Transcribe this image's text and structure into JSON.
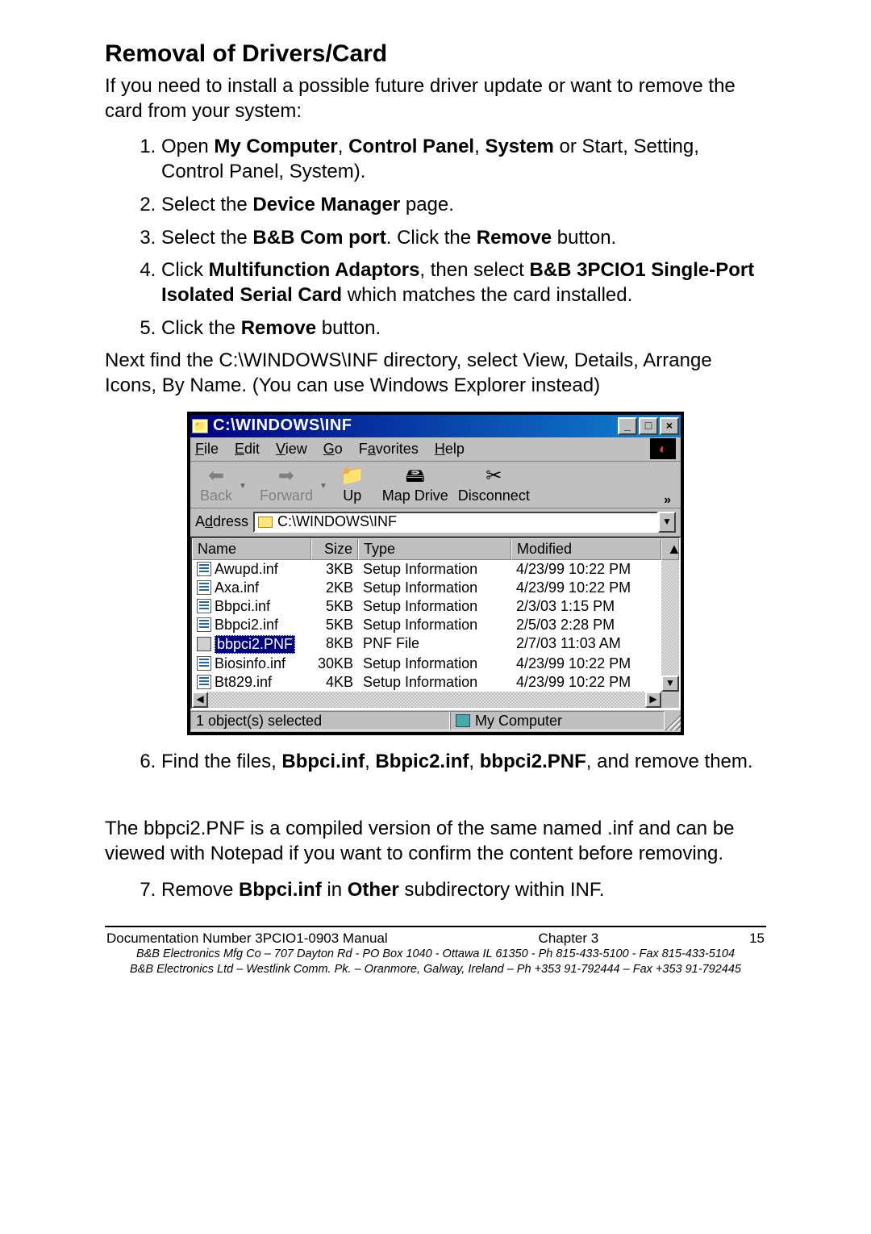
{
  "heading": "Removal of Drivers/Card",
  "intro": "If you need to install a possible future driver update or want to remove the card from your system:",
  "steps": {
    "s1_pre": "Open ",
    "s1_b1": "My Computer",
    "s1_mid1": ", ",
    "s1_b2": "Control Panel",
    "s1_mid2": ", ",
    "s1_b3": "System",
    "s1_post": " or Start, Setting, Control Panel, System).",
    "s2_pre": "Select the ",
    "s2_b": "Device Manager",
    "s2_post": " page.",
    "s3_pre": "Select the ",
    "s3_b1": "B&B Com port",
    "s3_mid": ". Click the ",
    "s3_b2": "Remove",
    "s3_post": " button.",
    "s4_pre": "Click ",
    "s4_b1": "Multifunction Adaptors",
    "s4_mid1": ", then select ",
    "s4_b2": "B&B 3PCIO1 Single-Port Isolated Serial Card",
    "s4_post": " which matches the card installed.",
    "s5_pre": "Click the ",
    "s5_b": "Remove",
    "s5_post": " button."
  },
  "after5": "Next find the C:\\WINDOWS\\INF directory, select View, Details, Arrange Icons, By Name. (You can use Windows Explorer instead)",
  "step6": {
    "pre": "Find the files, ",
    "b1": "Bbpci.inf",
    "m1": ", ",
    "b2": "Bbpic2.inf",
    "m2": ", ",
    "b3": "bbpci2.PNF",
    "post": ", and remove them."
  },
  "after6": "The bbpci2.PNF is a compiled version of the same named .inf and can be viewed with Notepad if you want to confirm the content before removing.",
  "step7": {
    "pre": "Remove ",
    "b1": "Bbpci.inf",
    "mid": " in ",
    "b2": "Other",
    "post": " subdirectory within INF."
  },
  "explorer": {
    "title": "C:\\WINDOWS\\INF",
    "menus": {
      "file": "File",
      "edit": "Edit",
      "view": "View",
      "go": "Go",
      "favorites": "Favorites",
      "help": "Help"
    },
    "toolbar": {
      "back": "Back",
      "forward": "Forward",
      "up": "Up",
      "map": "Map Drive",
      "disconnect": "Disconnect",
      "overflow": "»"
    },
    "address_label": "Address",
    "address_value": "C:\\WINDOWS\\INF",
    "columns": {
      "name": "Name",
      "size": "Size",
      "type": "Type",
      "modified": "Modified"
    },
    "rows": [
      {
        "name": "Awupd.inf",
        "size": "3KB",
        "type": "Setup Information",
        "modified": "4/23/99 10:22 PM",
        "icon": "inf",
        "selected": false
      },
      {
        "name": "Axa.inf",
        "size": "2KB",
        "type": "Setup Information",
        "modified": "4/23/99 10:22 PM",
        "icon": "inf",
        "selected": false
      },
      {
        "name": "Bbpci.inf",
        "size": "5KB",
        "type": "Setup Information",
        "modified": "2/3/03 1:15 PM",
        "icon": "inf",
        "selected": false
      },
      {
        "name": "Bbpci2.inf",
        "size": "5KB",
        "type": "Setup Information",
        "modified": "2/5/03 2:28 PM",
        "icon": "inf",
        "selected": false
      },
      {
        "name": "bbpci2.PNF",
        "size": "8KB",
        "type": "PNF File",
        "modified": "2/7/03 11:03 AM",
        "icon": "pnf",
        "selected": true
      },
      {
        "name": "Biosinfo.inf",
        "size": "30KB",
        "type": "Setup Information",
        "modified": "4/23/99 10:22 PM",
        "icon": "inf",
        "selected": false
      },
      {
        "name": "Bt829.inf",
        "size": "4KB",
        "type": "Setup Information",
        "modified": "4/23/99 10:22 PM",
        "icon": "inf",
        "selected": false
      }
    ],
    "status_left": "1 object(s) selected",
    "status_right": "My Computer"
  },
  "footer": {
    "doc": "Documentation Number 3PCIO1-0903 Manual",
    "chapter": "Chapter 3",
    "page": "15",
    "line2": "B&B Electronics Mfg Co – 707 Dayton Rd - PO Box 1040 - Ottawa IL 61350 - Ph 815-433-5100 - Fax 815-433-5104",
    "line3": "B&B Electronics Ltd – Westlink Comm. Pk. – Oranmore, Galway, Ireland – Ph +353 91-792444 – Fax +353 91-792445"
  }
}
